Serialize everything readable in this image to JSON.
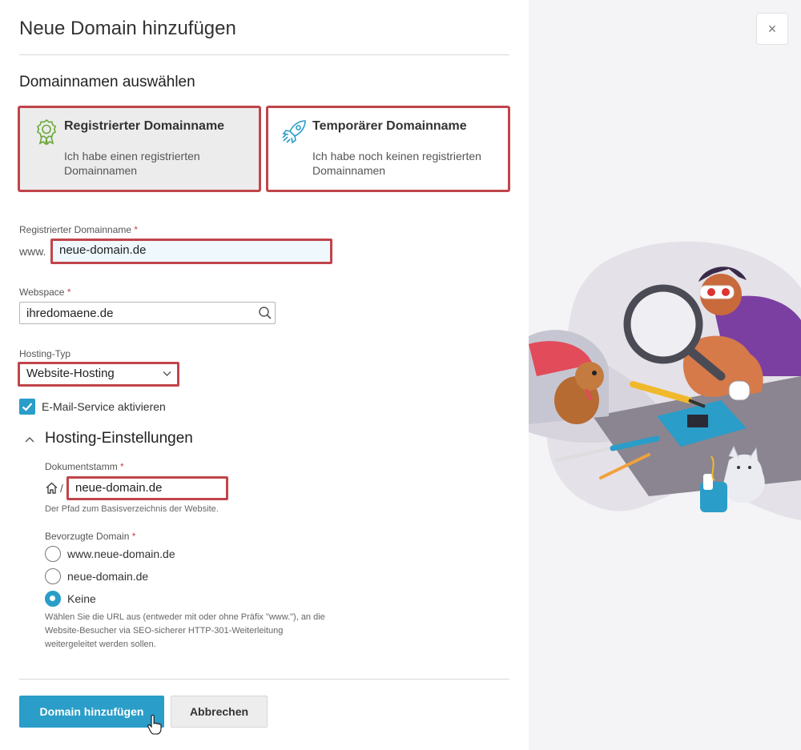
{
  "dialog": {
    "title": "Neue Domain hinzufügen",
    "section_title": "Domainnamen auswählen",
    "cards": [
      {
        "title": "Registrierter Domainname",
        "description": "Ich habe einen registrierten Domainnamen",
        "icon": "award-badge-icon"
      },
      {
        "title": "Temporärer Domainname",
        "description": "Ich habe noch keinen registrierten Domainnamen",
        "icon": "rocket-icon"
      }
    ],
    "domain_field": {
      "label": "Registrierter Domainname",
      "required": "*",
      "prefix": "www.",
      "value": "neue-domain.de"
    },
    "webspace_field": {
      "label": "Webspace",
      "required": "*",
      "value": "ihredomaene.de"
    },
    "hosting_type": {
      "label": "Hosting-Typ",
      "value": "Website-Hosting"
    },
    "email_service": {
      "label": "E-Mail-Service aktivieren",
      "checked": true
    },
    "hosting_settings": {
      "title": "Hosting-Einstellungen",
      "docroot": {
        "label": "Dokumentstamm",
        "required": "*",
        "separator": "/",
        "value": "neue-domain.de",
        "hint": "Der Pfad zum Basisverzeichnis der Website."
      },
      "preferred_domain": {
        "label": "Bevorzugte Domain",
        "required": "*",
        "options": [
          "www.neue-domain.de",
          "neue-domain.de",
          "Keine"
        ],
        "selected": "Keine",
        "hint_lines": [
          "Wählen Sie die URL aus (entweder mit oder ohne Präfix \"www.\"), an die",
          "Website-Besucher via SEO-sicherer HTTP-301-Weiterleitung",
          "weitergeleitet werden sollen."
        ]
      }
    },
    "buttons": {
      "add": "Domain hinzufügen",
      "cancel": "Abbrechen"
    }
  },
  "close_label": "×",
  "colors": {
    "accent": "#2a9dc9",
    "highlight": "#c0454b"
  }
}
